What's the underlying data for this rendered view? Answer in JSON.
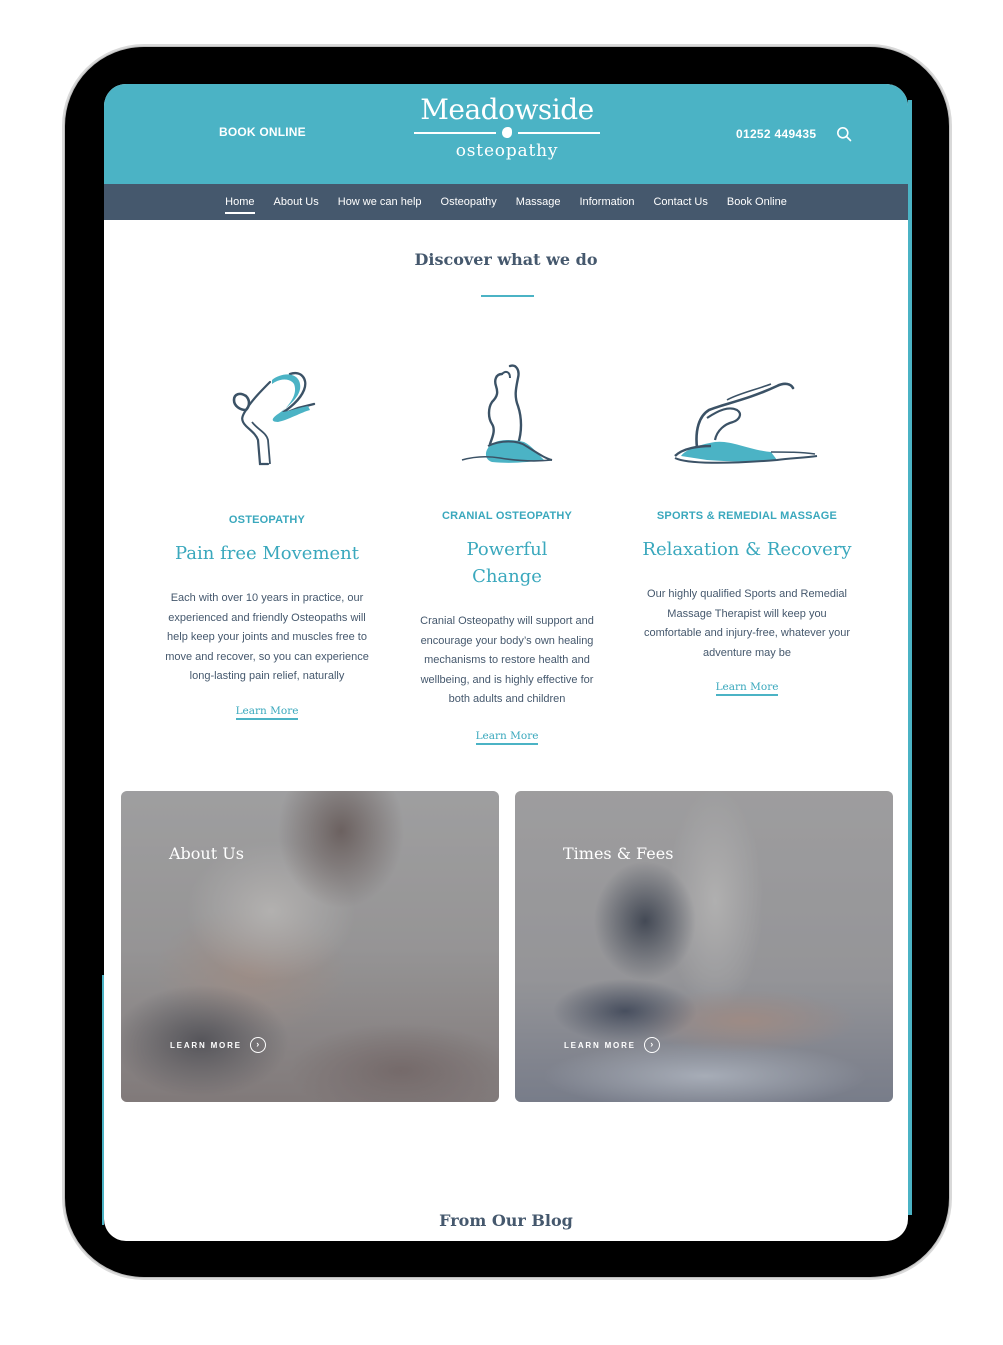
{
  "header": {
    "book_online": "BOOK ONLINE",
    "logo_title": "Meadowside",
    "logo_subtitle": "osteopathy",
    "phone": "01252 449435",
    "search_icon": "search-icon"
  },
  "nav": {
    "items": [
      {
        "label": "Home",
        "active": true
      },
      {
        "label": "About Us"
      },
      {
        "label": "How we can help"
      },
      {
        "label": "Osteopathy"
      },
      {
        "label": "Massage"
      },
      {
        "label": "Information"
      },
      {
        "label": "Contact Us"
      },
      {
        "label": "Book Online"
      }
    ]
  },
  "discover": {
    "title": "Discover what we do",
    "columns": [
      {
        "icon": "crow-pose-figure-icon",
        "kicker": "OSTEOPATHY",
        "heading": "Pain free Movement",
        "body": "Each with over 10 years in practice, our experienced and friendly Osteopaths will help keep your joints and muscles free to move and recover, so you can experience long-lasting pain relief, naturally",
        "link": "Learn More"
      },
      {
        "icon": "seated-stretch-figure-icon",
        "kicker": "CRANIAL OSTEOPATHY",
        "heading": "Powerful Change",
        "body": "Cranial Osteopathy will support and encourage your body’s own healing mechanisms to restore health and wellbeing, and is highly effective for both adults and children",
        "link": "Learn More"
      },
      {
        "icon": "pigeon-pose-figure-icon",
        "kicker": "SPORTS & REMEDIAL MASSAGE",
        "heading": "Relaxation & Recovery",
        "body": "Our highly qualified Sports and Remedial Massage Therapist will keep you comfortable and injury-free, whatever your adventure may be",
        "link": "Learn More"
      }
    ]
  },
  "cards": [
    {
      "title": "About Us",
      "cta": "LEARN MORE"
    },
    {
      "title": "Times & Fees",
      "cta": "LEARN MORE"
    }
  ],
  "blog": {
    "title": "From Our Blog"
  },
  "colors": {
    "brand_teal": "#4bb3c5",
    "nav_slate": "#45586d",
    "accent_text": "#3aa8bd"
  }
}
